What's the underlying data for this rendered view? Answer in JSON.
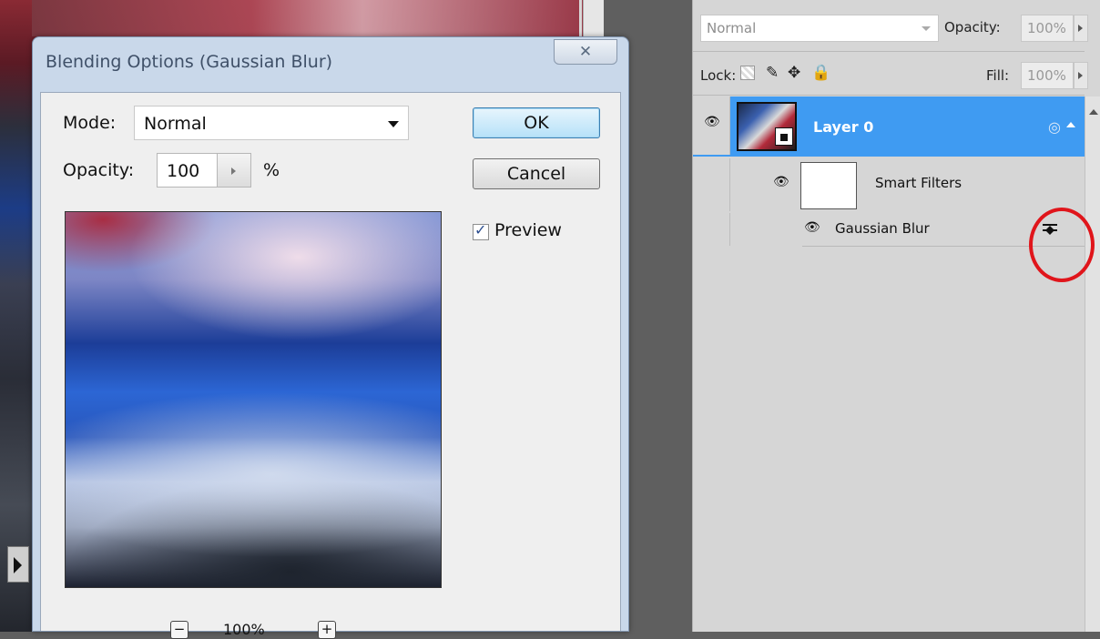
{
  "dialog": {
    "title": "Blending Options (Gaussian Blur)",
    "close_icon": "✕",
    "mode_label": "Mode:",
    "mode_value": "Normal",
    "opacity_label": "Opacity:",
    "opacity_value": "100",
    "opacity_unit": "%",
    "ok_label": "OK",
    "cancel_label": "Cancel",
    "preview_label": "Preview",
    "preview_checked": true,
    "zoom_out": "−",
    "zoom_level": "100%",
    "zoom_in": "+"
  },
  "layers_panel": {
    "blend_mode": "Normal",
    "opacity_label": "Opacity:",
    "opacity_value": "100%",
    "lock_label": "Lock:",
    "fill_label": "Fill:",
    "fill_value": "100%",
    "layers": [
      {
        "name": "Layer 0",
        "selected": true,
        "visible": true
      },
      {
        "name": "Smart Filters",
        "visible": true
      },
      {
        "name": "Gaussian Blur",
        "visible": true
      }
    ]
  },
  "icons": {
    "eye": "eye-icon",
    "lock_transparent": "lock-transparent-pixels-icon",
    "brush": "brush-icon",
    "move": "move-icon",
    "padlock": "padlock-icon",
    "filter_options": "filter-blending-options-icon",
    "smart_object": "smart-object-icon"
  },
  "colors": {
    "selected_layer": "#3f9bf2",
    "highlight_ring": "#e0151b",
    "ok_button": "#b6e1f8"
  }
}
